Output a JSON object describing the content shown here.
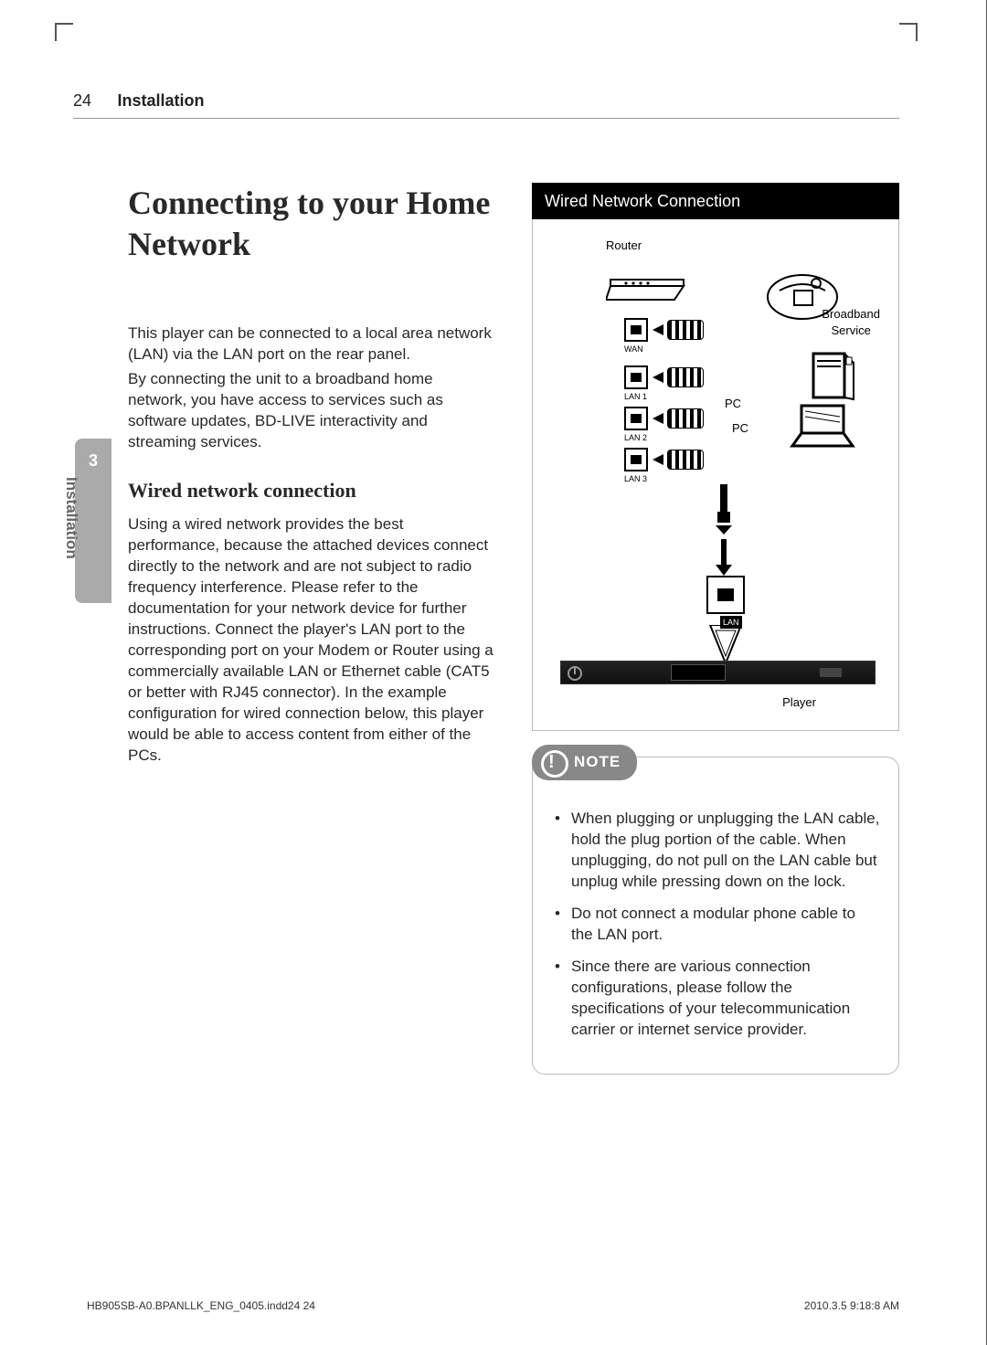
{
  "header": {
    "page_number": "24",
    "section": "Installation"
  },
  "side_tab": {
    "chapter": "3",
    "label": "Installation"
  },
  "left": {
    "title": "Connecting to your Home Network",
    "intro_p1": "This player can be connected to a local area network (LAN) via the LAN port on the rear panel.",
    "intro_p2": "By connecting the unit to a broadband home network, you have access to services such as software updates, BD-LIVE interactivity and streaming services.",
    "subhead": "Wired network connection",
    "body_p1": "Using a wired network provides the best performance, because the attached devices connect directly to the network and are not subject to radio frequency interference. Please refer to the documentation for your network device for further instructions. Connect the player's LAN port to the corresponding port on your Modem or Router using a commercially available LAN or Ethernet cable (CAT5 or better with RJ45 connector). In the example configuration for wired connection below, this player would be able to access content from either of the PCs."
  },
  "diagram": {
    "title": "Wired Network Connection",
    "router_label": "Router",
    "broadband_label_1": "Broadband",
    "broadband_label_2": "Service",
    "wan_label": "WAN",
    "lan1_label": "LAN 1",
    "lan2_label": "LAN 2",
    "lan3_label": "LAN 3",
    "pc_label_1": "PC",
    "pc_label_2": "PC",
    "lan_port_label": "LAN",
    "player_label": "Player"
  },
  "note": {
    "heading": "NOTE",
    "items": [
      "When plugging or unplugging the LAN cable, hold the plug portion of the cable. When unplugging, do not pull on the LAN cable but unplug while pressing down on the lock.",
      "Do not connect a modular phone cable to the LAN port.",
      "Since there are various connection configurations, please follow the specifications of your telecommunication carrier or internet service provider."
    ]
  },
  "footer": {
    "file": "HB905SB-A0.BPANLLK_ENG_0405.indd24   24",
    "timestamp": "2010.3.5   9:18:8 AM"
  }
}
